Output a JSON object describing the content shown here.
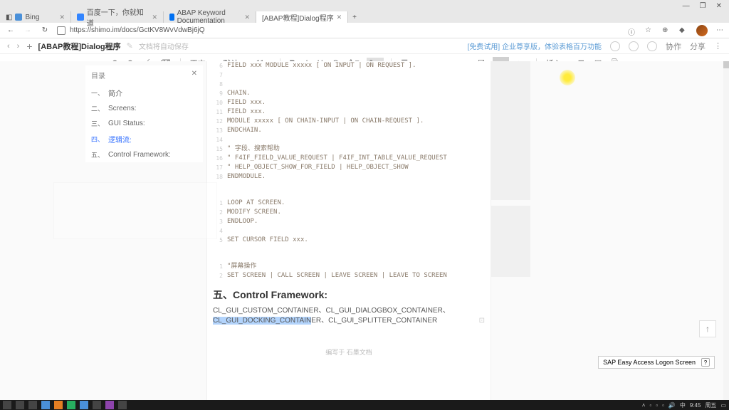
{
  "browser": {
    "tabs": [
      {
        "label": "Bing"
      },
      {
        "label": "百度一下，你就知道"
      },
      {
        "label": "ABAP Keyword Documentation"
      },
      {
        "label": "[ABAP教程]Dialog程序"
      }
    ],
    "url": "https://shimo.im/docs/GctKV8WvVdwBj6jQ"
  },
  "doc": {
    "title": "[ABAP教程]Dialog程序",
    "autosave": "文档将自动保存",
    "promo": "[免费试用] 企业尊享版，体验表格百万功能",
    "collab": "协作",
    "share": "分享",
    "font_size": "11",
    "heading_label": "正文",
    "style_label": "默认"
  },
  "outline": {
    "title": "目录",
    "items": [
      {
        "num": "一、",
        "label": "简介"
      },
      {
        "num": "二、",
        "label": "Screens:"
      },
      {
        "num": "三、",
        "label": "GUI Status:"
      },
      {
        "num": "四、",
        "label": "逻辑流:",
        "active": true
      },
      {
        "num": "五、",
        "label": "Control Framework:"
      }
    ]
  },
  "code": {
    "l6": "FIELD xxx MODULE xxxxx [ ON INPUT | ON REQUEST ].",
    "l9": "CHAIN.",
    "l10": "FIELD xxx.",
    "l11": "FIELD xxx.",
    "l12": "MODULE xxxxx [ ON CHAIN-INPUT | ON CHAIN-REQUEST ].",
    "l13": "ENDCHAIN.",
    "l15": "\" 字段、搜索帮助",
    "l16": "\" F4IF_FIELD_VALUE_REQUEST | F4IF_INT_TABLE_VALUE_REQUEST",
    "l17": "\" HELP_OBJECT_SHOW_FOR_FIELD | HELP_OBJECT_SHOW",
    "l18": "ENDMODULE.",
    "b1": "LOOP AT SCREEN.",
    "b2": "MODIFY SCREEN.",
    "b3": "ENDLOOP.",
    "b5": "SET CURSOR FIELD xxx.",
    "c1": "\"屏幕操作",
    "c2": "SET SCREEN | CALL SCREEN | LEAVE SCREEN | LEAVE TO SCREEN"
  },
  "section5": {
    "heading": "五、Control Framework:",
    "line1": "CL_GUI_CUSTOM_CONTAINER、CL_GUI_DIALOGBOX_CONTAINER、",
    "line2_sel": "CL_GUI_DOCKING_CONTAIN",
    "line2_rest": "ER、CL_GUI_SPLITTER_CONTAINER"
  },
  "signature": "编写于 石墨文档",
  "sap_tooltip": "SAP Easy Access Logon Screen",
  "taskbar": {
    "time": "9:45",
    "date": "周五"
  }
}
